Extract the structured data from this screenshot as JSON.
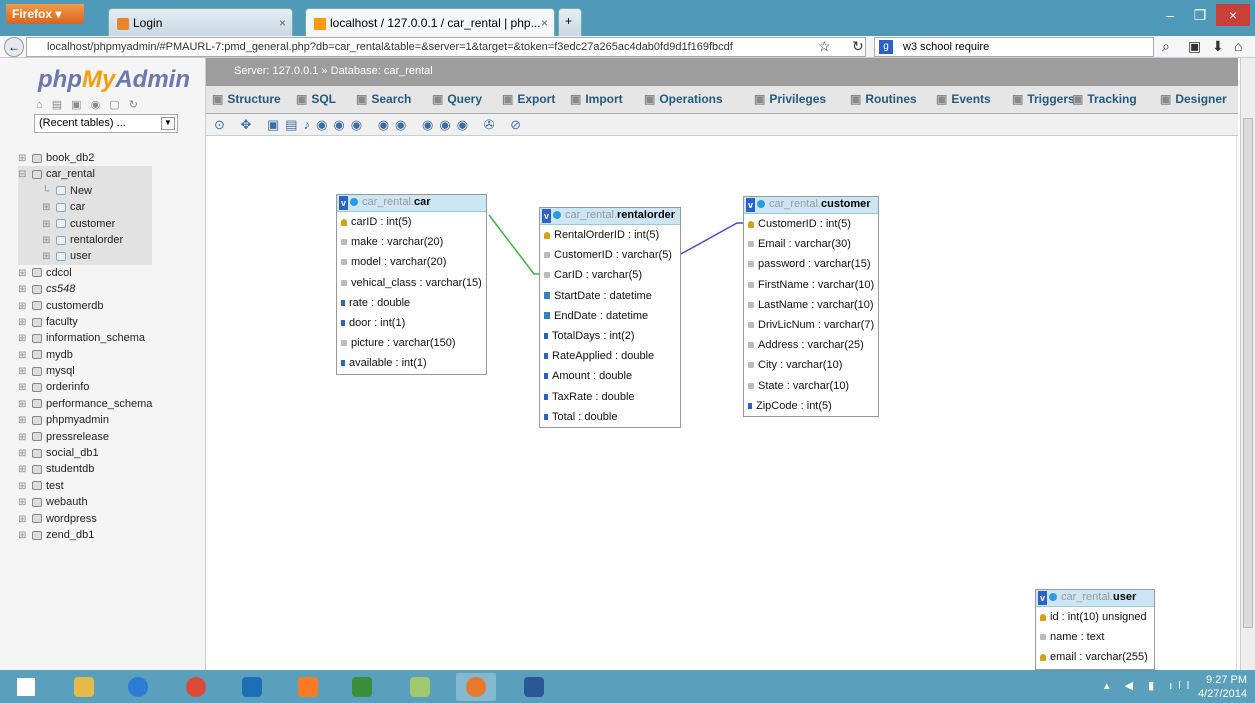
{
  "browser": {
    "app_button": "Firefox",
    "tabs": [
      {
        "title": "Login"
      },
      {
        "title": "localhost / 127.0.0.1 / car_rental | php...",
        "active": true
      }
    ],
    "url": "localhost/phpmyadmin/#PMAURL-7:pmd_general.php?db=car_rental&table=&server=1&target=&token=f3edc27a265ac4dab0fd9d1f169fbcdf",
    "search_value": "w3 school require"
  },
  "sidebar": {
    "logo_php": "php",
    "logo_my": "My",
    "logo_admin": "Admin",
    "recent": "(Recent tables) ...",
    "databases": [
      {
        "name": "book_db2"
      },
      {
        "name": "car_rental",
        "children": [
          "New",
          "car",
          "customer",
          "rentalorder",
          "user"
        ]
      },
      {
        "name": "cdcol"
      },
      {
        "name": "cs548"
      },
      {
        "name": "customerdb"
      },
      {
        "name": "faculty"
      },
      {
        "name": "information_schema"
      },
      {
        "name": "mydb"
      },
      {
        "name": "mysql"
      },
      {
        "name": "orderinfo"
      },
      {
        "name": "performance_schema"
      },
      {
        "name": "phpmyadmin"
      },
      {
        "name": "pressrelease"
      },
      {
        "name": "social_db1"
      },
      {
        "name": "studentdb"
      },
      {
        "name": "test"
      },
      {
        "name": "webauth"
      },
      {
        "name": "wordpress"
      },
      {
        "name": "zend_db1"
      }
    ]
  },
  "breadcrumb": {
    "server": "Server: 127.0.0.1",
    "database": "Database: car_rental"
  },
  "tabs": [
    "Structure",
    "SQL",
    "Search",
    "Query",
    "Export",
    "Import",
    "Operations",
    "Privileges",
    "Routines",
    "Events",
    "Triggers",
    "Tracking",
    "Designer"
  ],
  "designer": {
    "tables": {
      "car": {
        "db": "car_rental.",
        "name": "car",
        "cols": [
          "carID : int(5)",
          "make : varchar(20)",
          "model : varchar(20)",
          "vehical_class : varchar(15)",
          "rate : double",
          "door : int(1)",
          "picture : varchar(150)",
          "available : int(1)"
        ],
        "types": [
          "key",
          "str",
          "str",
          "str",
          "num",
          "num",
          "str",
          "num"
        ]
      },
      "rentalorder": {
        "db": "car_rental.",
        "name": "rentalorder",
        "cols": [
          "RentalOrderID : int(5)",
          "CustomerID : varchar(5)",
          "CarID : varchar(5)",
          "StartDate : datetime",
          "EndDate : datetime",
          "TotalDays : int(2)",
          "RateApplied : double",
          "Amount : double",
          "TaxRate : double",
          "Total : double"
        ],
        "types": [
          "key",
          "str",
          "str",
          "date",
          "date",
          "num",
          "num",
          "num",
          "num",
          "num"
        ]
      },
      "customer": {
        "db": "car_rental.",
        "name": "customer",
        "cols": [
          "CustomerID : int(5)",
          "Email : varchar(30)",
          "password : varchar(15)",
          "FirstName : varchar(10)",
          "LastName : varchar(10)",
          "DrivLicNum : varchar(7)",
          "Address : varchar(25)",
          "City : varchar(10)",
          "State : varchar(10)",
          "ZipCode : int(5)"
        ],
        "types": [
          "key",
          "str",
          "str",
          "str",
          "str",
          "str",
          "str",
          "str",
          "str",
          "num"
        ]
      },
      "user": {
        "db": "car_rental.",
        "name": "user",
        "cols": [
          "id : int(10) unsigned",
          "name : text",
          "email : varchar(255)"
        ],
        "types": [
          "key",
          "str",
          "key"
        ]
      }
    }
  },
  "taskbar": {
    "time": "9:27 PM",
    "date": "4/27/2014"
  }
}
